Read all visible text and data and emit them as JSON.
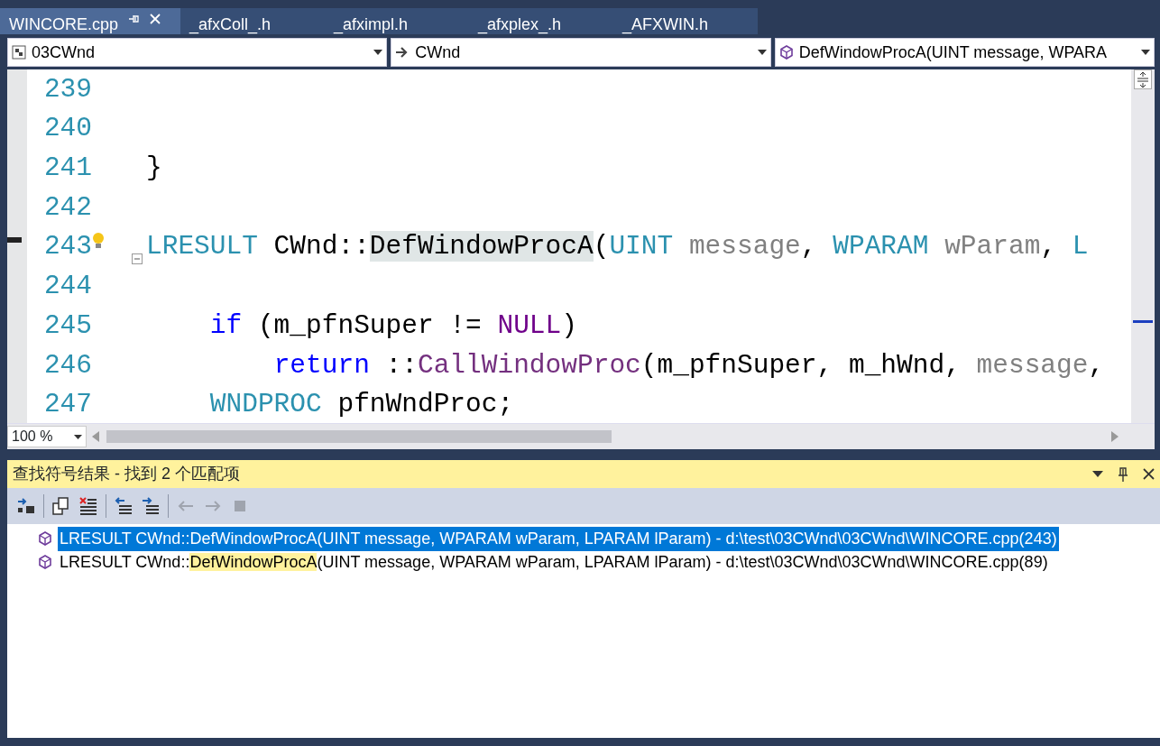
{
  "tabs": [
    {
      "label": "WINCORE.cpp",
      "selected": true,
      "pinned": true
    },
    {
      "label": "_afxColl_.h",
      "selected": false,
      "pinned": false
    },
    {
      "label": "_afximpl.h",
      "selected": false,
      "pinned": false
    },
    {
      "label": "_afxplex_.h",
      "selected": false,
      "pinned": false
    },
    {
      "label": "_AFXWIN.h",
      "selected": false,
      "pinned": false
    }
  ],
  "navigation": [
    {
      "kind": "project",
      "value": "03CWnd"
    },
    {
      "kind": "class",
      "value": "CWnd"
    },
    {
      "kind": "member",
      "value": "DefWindowProcA(UINT message, WPARA"
    }
  ],
  "editor": {
    "lines": [
      {
        "number": "239"
      },
      {
        "number": "240"
      },
      {
        "number": "241",
        "tokens": [
          {
            "text": "}",
            "kind": "plain"
          }
        ]
      },
      {
        "number": "242"
      },
      {
        "number": "243",
        "bookmark": true,
        "lightbulb": true,
        "collapsible": true,
        "tokens": [
          {
            "text": "LRESULT",
            "kind": "type"
          },
          {
            "text": " CWnd::",
            "kind": "plain"
          },
          {
            "text": "DefWindowProcA",
            "kind": "reference"
          },
          {
            "text": "(",
            "kind": "plain"
          },
          {
            "text": "UINT",
            "kind": "type"
          },
          {
            "text": " message",
            "kind": "param"
          },
          {
            "text": ", ",
            "kind": "plain"
          },
          {
            "text": "WPARAM",
            "kind": "type"
          },
          {
            "text": " wParam",
            "kind": "param"
          },
          {
            "text": ", ",
            "kind": "plain"
          },
          {
            "text": "L",
            "kind": "type"
          }
        ],
        "children": [
          {
            "number": "244"
          },
          {
            "number": "245",
            "tokens": [
              {
                "text": "if",
                "kind": "keyword"
              },
              {
                "text": " (m_pfnSuper != ",
                "kind": "plain"
              },
              {
                "text": "NULL",
                "kind": "macro"
              },
              {
                "text": ")",
                "kind": "plain"
              }
            ],
            "children": [
              {
                "number": "246",
                "tokens": [
                  {
                    "text": "return",
                    "kind": "keyword"
                  },
                  {
                    "text": " ::",
                    "kind": "plain"
                  },
                  {
                    "text": "CallWindowProc",
                    "kind": "function"
                  },
                  {
                    "text": "(m_pfnSuper, m_hWnd, ",
                    "kind": "plain"
                  },
                  {
                    "text": "message",
                    "kind": "param"
                  },
                  {
                    "text": ",",
                    "kind": "plain"
                  }
                ]
              }
            ]
          },
          {
            "number": "247",
            "tokens": [
              {
                "text": "WNDPROC",
                "kind": "type"
              },
              {
                "text": " pfnWndProc;",
                "kind": "plain"
              }
            ]
          }
        ]
      }
    ],
    "zoom": "100 %"
  },
  "results_panel": {
    "title": "查找符号结果 - 找到 2 个匹配项",
    "toolbar": [
      {
        "kind": "goto",
        "disabled": false
      },
      {
        "kind": "sep"
      },
      {
        "kind": "copy",
        "disabled": false
      },
      {
        "kind": "clear",
        "disabled": false
      },
      {
        "kind": "sep"
      },
      {
        "kind": "prev-list",
        "disabled": false
      },
      {
        "kind": "next-list",
        "disabled": false
      },
      {
        "kind": "sep"
      },
      {
        "kind": "back",
        "disabled": true
      },
      {
        "kind": "forward",
        "disabled": true
      },
      {
        "kind": "stop",
        "disabled": true
      }
    ],
    "results": [
      {
        "prefix": "LRESULT CWnd::",
        "match": "DefWindowProcA",
        "suffix": "(UINT message, WPARAM wParam, LPARAM lParam) - d:\\test\\03CWnd\\03CWnd\\WINCORE.cpp(243)",
        "selected": true
      },
      {
        "prefix": "LRESULT CWnd::",
        "match": "DefWindowProcA",
        "suffix": "(UINT message, WPARAM wParam, LPARAM lParam) - d:\\test\\03CWnd\\03CWnd\\WINCORE.cpp(89)",
        "selected": false
      }
    ]
  }
}
